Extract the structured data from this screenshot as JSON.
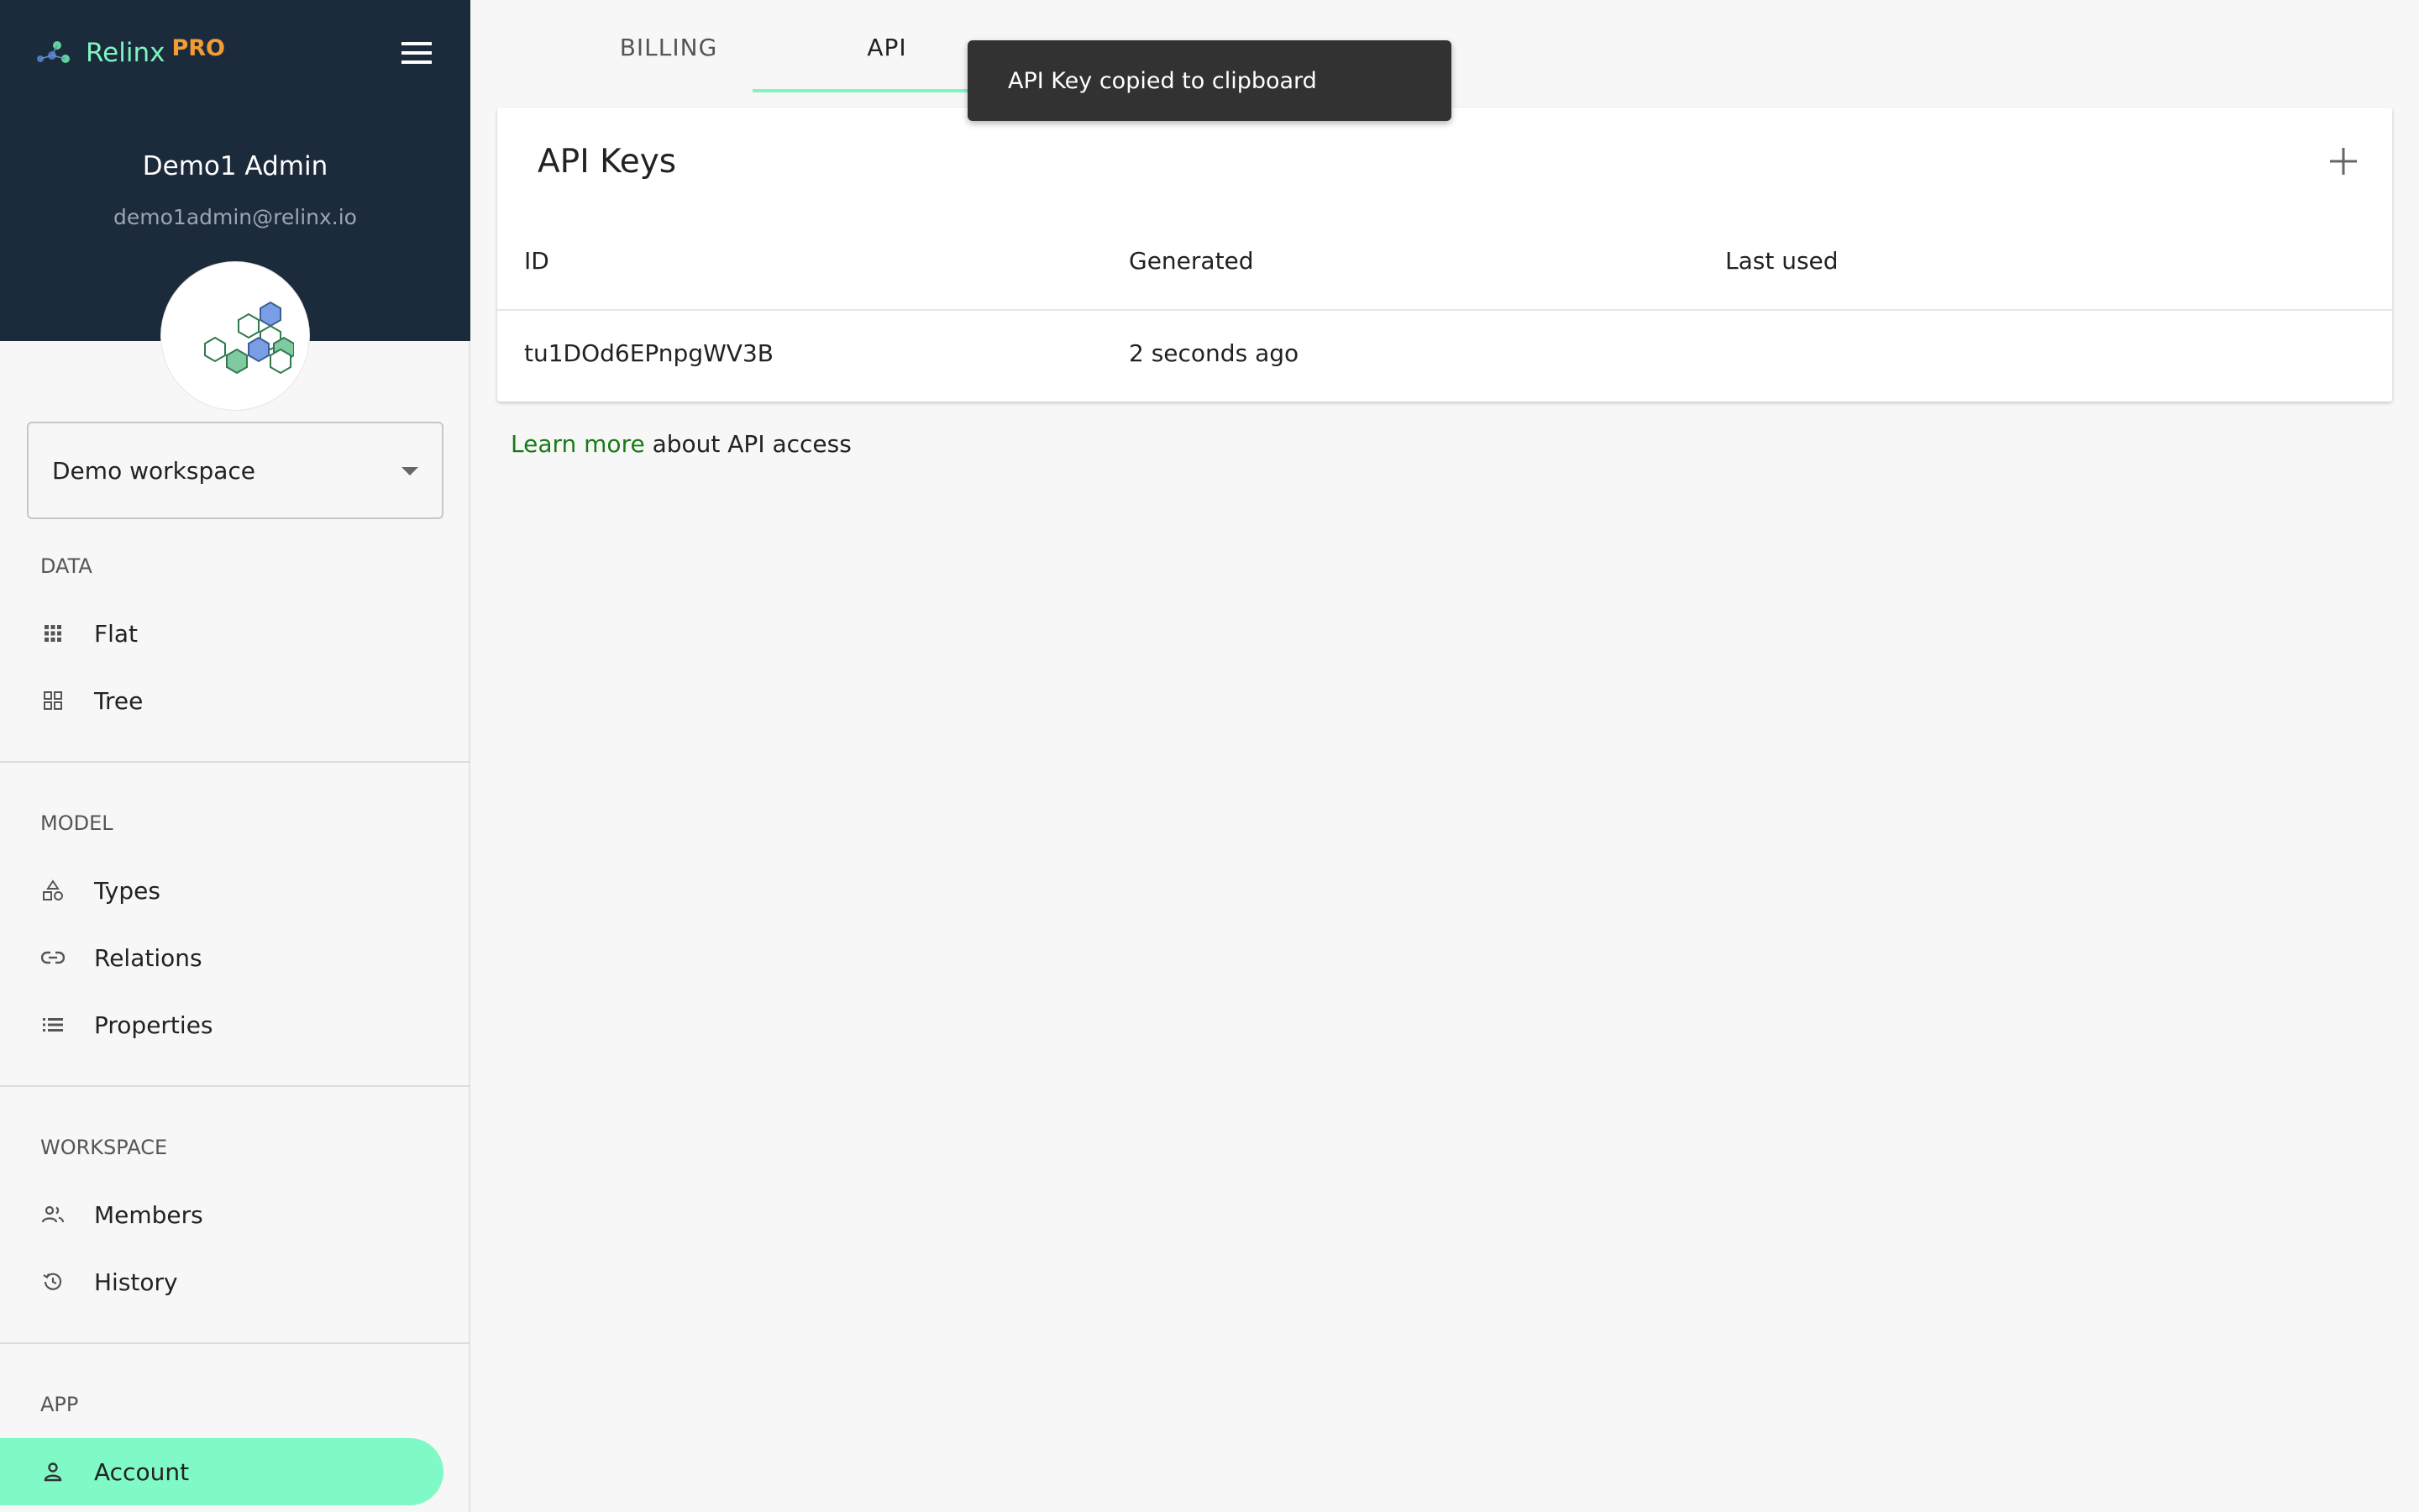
{
  "brand": {
    "name": "Relinx",
    "tier": "PRO"
  },
  "user": {
    "name": "Demo1 Admin",
    "email": "demo1admin@relinx.io"
  },
  "workspace": {
    "selected": "Demo workspace"
  },
  "sidebar": {
    "sections": [
      {
        "label": "DATA",
        "items": [
          {
            "label": "Flat",
            "icon": "grid-icon"
          },
          {
            "label": "Tree",
            "icon": "tree-icon"
          }
        ]
      },
      {
        "label": "MODEL",
        "items": [
          {
            "label": "Types",
            "icon": "shapes-icon"
          },
          {
            "label": "Relations",
            "icon": "link-icon"
          },
          {
            "label": "Properties",
            "icon": "list-icon"
          }
        ]
      },
      {
        "label": "WORKSPACE",
        "items": [
          {
            "label": "Members",
            "icon": "people-icon"
          },
          {
            "label": "History",
            "icon": "history-icon"
          }
        ]
      },
      {
        "label": "APP",
        "items": [
          {
            "label": "Account",
            "icon": "person-icon",
            "active": true
          }
        ]
      }
    ]
  },
  "tabs": [
    {
      "label": "BILLING"
    },
    {
      "label": "API",
      "active": true
    }
  ],
  "api_keys": {
    "title": "API Keys",
    "columns": [
      "ID",
      "Generated",
      "Last used"
    ],
    "rows": [
      {
        "id": "tu1DOd6EPnpgWV3B",
        "generated": "2 seconds ago",
        "last_used": ""
      }
    ]
  },
  "learn_more": {
    "link": "Learn more",
    "text": " about API access"
  },
  "toast": {
    "message": "API Key copied to clipboard"
  },
  "colors": {
    "sidebar_header": "#1c2b3c",
    "accent": "#7ff5c2",
    "pro": "#f39c34",
    "link": "#1a7a1a",
    "toast_bg": "#323232"
  }
}
